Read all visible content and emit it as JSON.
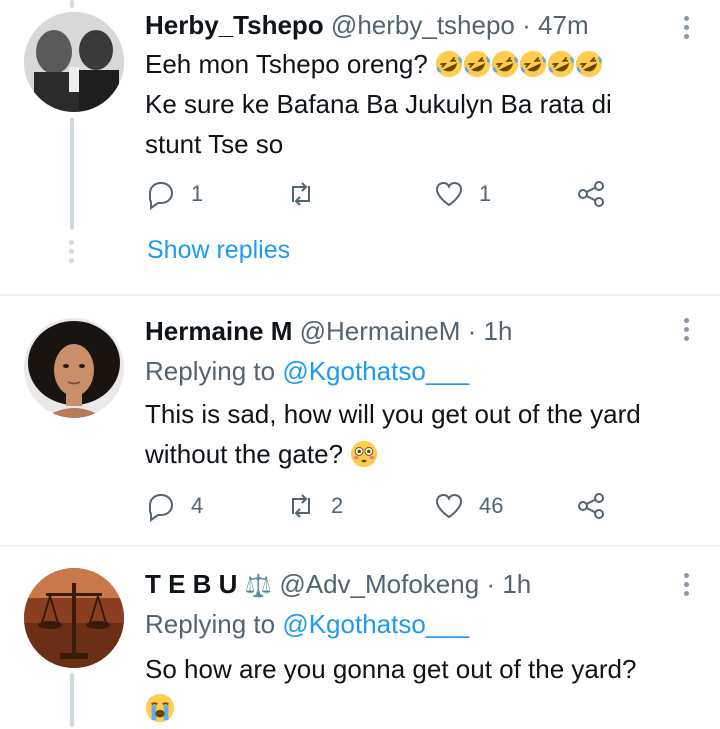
{
  "tweets": [
    {
      "name": "Herby_Tshepo",
      "handle": "@herby_tshepo",
      "sep": "·",
      "time": "47m",
      "text_line1": "Eeh mon Tshepo oreng?",
      "text_line2": "Ke sure ke Bafana Ba Jukulyn Ba rata di",
      "text_line3": "stunt Tse so",
      "emoji_count_laughing": 6,
      "reply_count": "1",
      "retweet_count": "",
      "like_count": "1",
      "show_replies": "Show replies"
    },
    {
      "name": "Hermaine M",
      "handle": "@HermaineM",
      "sep": "·",
      "time": "1h",
      "replying_prefix": "Replying to",
      "replying_to": "@Kgothatso___",
      "text_line1": "This is sad, how will you get out of the yard",
      "text_line2": "without the gate?",
      "reply_count": "4",
      "retweet_count": "2",
      "like_count": "46"
    },
    {
      "name": "T E B U",
      "name_badge": "⚖️",
      "handle": "@Adv_Mofokeng",
      "sep": "·",
      "time": "1h",
      "replying_prefix": "Replying to",
      "replying_to": "@Kgothatso___",
      "text_line1": "So how are you gonna get out of the yard?"
    }
  ],
  "icons": {
    "reply": "reply-icon",
    "retweet": "retweet-icon",
    "like": "heart-icon",
    "share": "share-icon",
    "more": "more-vertical-icon"
  },
  "colors": {
    "accent": "#1d9bf0",
    "muted": "#536471",
    "divider": "#eff3f4"
  }
}
